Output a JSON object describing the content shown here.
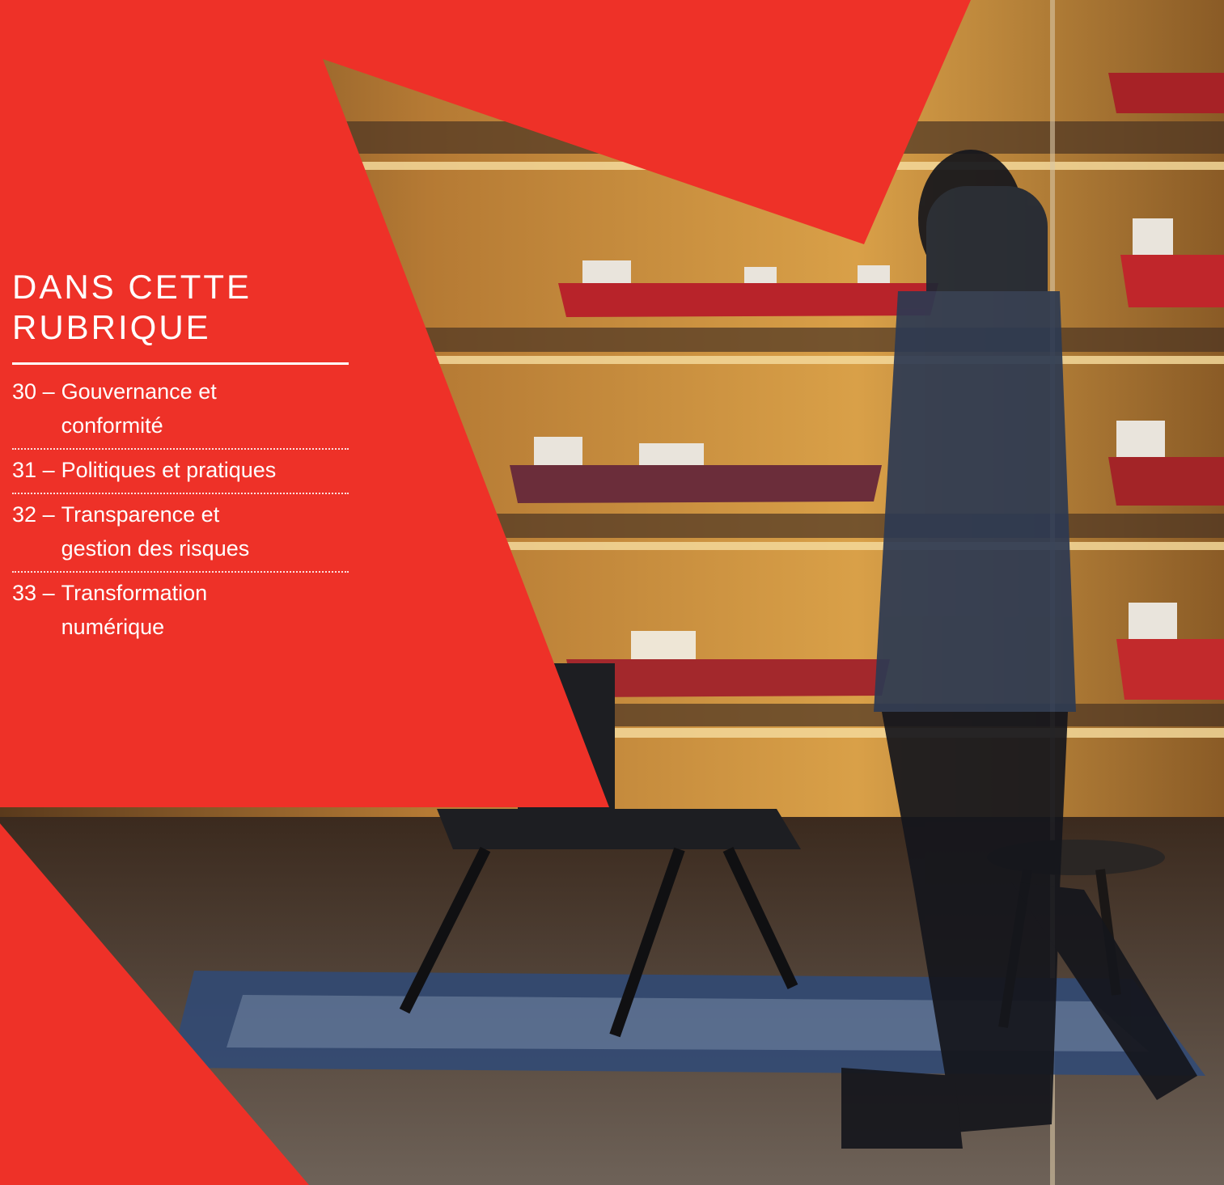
{
  "section_title_lines": [
    "DANS CETTE",
    "RUBRIQUE"
  ],
  "toc": [
    {
      "number": "30",
      "separator": "–",
      "label_lines": [
        "Gouvernance et",
        "conformité"
      ]
    },
    {
      "number": "31",
      "separator": "–",
      "label_lines": [
        "Politiques et pratiques"
      ]
    },
    {
      "number": "32",
      "separator": "–",
      "label_lines": [
        "Transparence et",
        "gestion des risques"
      ]
    },
    {
      "number": "33",
      "separator": "–",
      "label_lines": [
        "Transformation",
        "numérique"
      ]
    }
  ],
  "colors": {
    "accent": "#ee3128",
    "text": "#ffffff"
  }
}
